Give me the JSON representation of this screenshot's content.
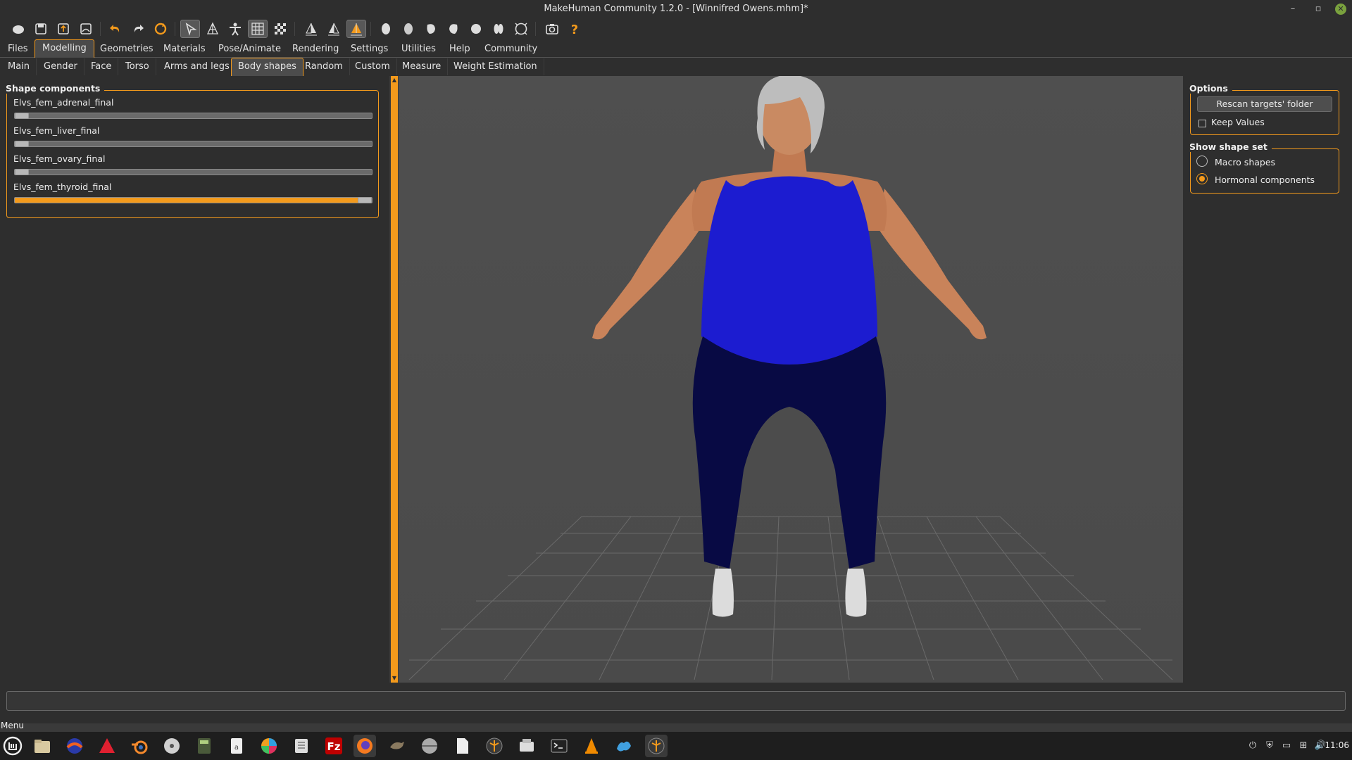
{
  "window": {
    "title": "MakeHuman Community 1.2.0 - [Winnifred Owens.mhm]*",
    "controls": [
      "–",
      "▫",
      "✕"
    ]
  },
  "menu_tabs": [
    {
      "label": "Files",
      "active": false
    },
    {
      "label": "Modelling",
      "active": true
    },
    {
      "label": "Geometries",
      "active": false
    },
    {
      "label": "Materials",
      "active": false
    },
    {
      "label": "Pose/Animate",
      "active": false
    },
    {
      "label": "Rendering",
      "active": false
    },
    {
      "label": "Settings",
      "active": false
    },
    {
      "label": "Utilities",
      "active": false
    },
    {
      "label": "Help",
      "active": false
    },
    {
      "label": "Community",
      "active": false
    }
  ],
  "sub_tabs": [
    {
      "label": "Main",
      "active": false
    },
    {
      "label": "Gender",
      "active": false
    },
    {
      "label": "Face",
      "active": false
    },
    {
      "label": "Torso",
      "active": false
    },
    {
      "label": "Arms and legs",
      "active": false
    },
    {
      "label": "Body shapes",
      "active": true
    },
    {
      "label": "Random",
      "active": false
    },
    {
      "label": "Custom",
      "active": false
    },
    {
      "label": "Measure",
      "active": false
    },
    {
      "label": "Weight Estimation",
      "active": false
    }
  ],
  "shape_components": {
    "title": "Shape components",
    "sliders": [
      {
        "label": "Elvs_fem_adrenal_final",
        "value": 0.0
      },
      {
        "label": "Elvs_fem_liver_final",
        "value": 0.0
      },
      {
        "label": "Elvs_fem_ovary_final",
        "value": 0.0
      },
      {
        "label": "Elvs_fem_thyroid_final",
        "value": 1.0
      }
    ]
  },
  "options": {
    "title": "Options",
    "rescan_label": "Rescan targets' folder",
    "keep_values_label": "Keep Values",
    "keep_values_checked": false
  },
  "shape_set": {
    "title": "Show shape set",
    "macro_label": "Macro shapes",
    "macro_selected": false,
    "hormonal_label": "Hormonal components",
    "hormonal_selected": true
  },
  "status": {
    "menu_label": "Menu",
    "clock": "11:06"
  },
  "colors": {
    "accent": "#f39a1c",
    "panel_bg": "#2e2e2e",
    "viewport_bg": "#4d4d4d",
    "top_color": "#1c1cd0",
    "pants_color": "#080a44"
  },
  "toolbar_icons": [
    "new-icon",
    "save-icon",
    "export-icon",
    "load-icon",
    "undo-icon",
    "redo-icon",
    "reset-icon",
    "smooth-icon",
    "wireframe-icon",
    "pose-icon",
    "grid-icon",
    "checker-icon",
    "symmetry-right-icon",
    "symmetry-left-icon",
    "symmetry-icon",
    "front-view-icon",
    "back-view-icon",
    "left-view-icon",
    "right-view-icon",
    "top-view-icon",
    "bottom-view-icon",
    "reset-camera-icon",
    "screenshot-icon",
    "help-icon"
  ],
  "taskbar_icons": [
    "mint-menu-icon",
    "files-icon",
    "app-icon",
    "vivaldi-icon",
    "blender-icon",
    "disc-icon",
    "calculator-icon",
    "text-icon",
    "color-icon",
    "archive-icon",
    "filezilla-icon",
    "firefox-icon",
    "gimp-icon",
    "disk-icon",
    "document-icon",
    "makehuman-icon",
    "typewriter-icon",
    "terminal-icon",
    "vlc-icon",
    "inkscape-icon",
    "makehuman-running-icon"
  ]
}
